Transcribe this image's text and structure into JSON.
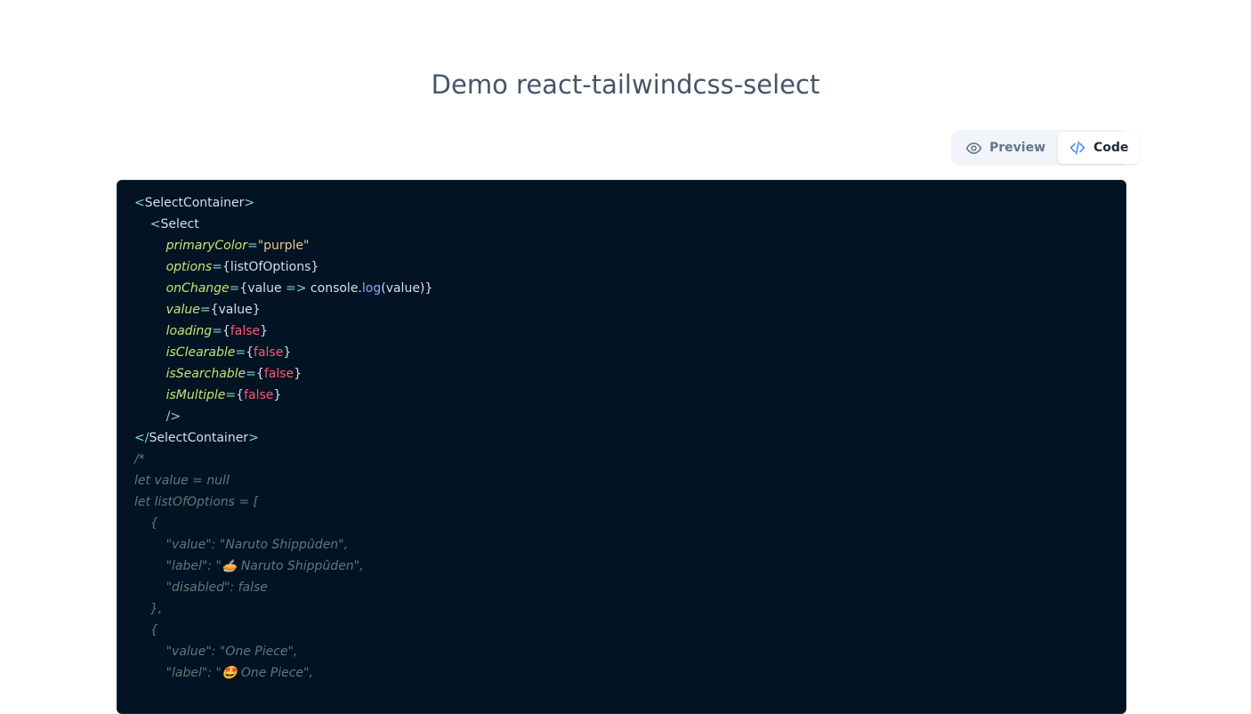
{
  "page": {
    "title": "Demo react-tailwindcss-select"
  },
  "tabs": [
    {
      "label": "Preview",
      "icon": "eye-icon",
      "active": false
    },
    {
      "label": "Code",
      "icon": "code-icon",
      "active": true
    }
  ],
  "code": {
    "lines": [
      [
        {
          "t": "<",
          "c": "punc"
        },
        {
          "t": "SelectContainer",
          "c": "tag"
        },
        {
          "t": ">",
          "c": "punc"
        }
      ],
      [
        {
          "t": "    <",
          "c": "punc"
        },
        {
          "t": "Select",
          "c": "tag"
        }
      ],
      [
        {
          "t": "        ",
          "c": "ident"
        },
        {
          "t": "primaryColor",
          "c": "attr"
        },
        {
          "t": "=",
          "c": "punc"
        },
        {
          "t": "\"purple\"",
          "c": "str"
        }
      ],
      [
        {
          "t": "        ",
          "c": "ident"
        },
        {
          "t": "options",
          "c": "attr"
        },
        {
          "t": "=",
          "c": "punc"
        },
        {
          "t": "{",
          "c": "brace"
        },
        {
          "t": "listOfOptions",
          "c": "ident"
        },
        {
          "t": "}",
          "c": "brace"
        }
      ],
      [
        {
          "t": "        ",
          "c": "ident"
        },
        {
          "t": "onChange",
          "c": "attr"
        },
        {
          "t": "=",
          "c": "punc"
        },
        {
          "t": "{",
          "c": "brace"
        },
        {
          "t": "value ",
          "c": "ident"
        },
        {
          "t": "=>",
          "c": "punc"
        },
        {
          "t": " console.",
          "c": "ident"
        },
        {
          "t": "log",
          "c": "call"
        },
        {
          "t": "(value)}",
          "c": "ident"
        }
      ],
      [
        {
          "t": "        ",
          "c": "ident"
        },
        {
          "t": "value",
          "c": "attr"
        },
        {
          "t": "=",
          "c": "punc"
        },
        {
          "t": "{",
          "c": "brace"
        },
        {
          "t": "value",
          "c": "ident"
        },
        {
          "t": "}",
          "c": "brace"
        }
      ],
      [
        {
          "t": "        ",
          "c": "ident"
        },
        {
          "t": "loading",
          "c": "attr"
        },
        {
          "t": "=",
          "c": "punc"
        },
        {
          "t": "{",
          "c": "brace"
        },
        {
          "t": "false",
          "c": "false"
        },
        {
          "t": "}",
          "c": "brace"
        }
      ],
      [
        {
          "t": "        ",
          "c": "ident"
        },
        {
          "t": "isClearable",
          "c": "attr"
        },
        {
          "t": "=",
          "c": "punc"
        },
        {
          "t": "{",
          "c": "brace"
        },
        {
          "t": "false",
          "c": "false"
        },
        {
          "t": "}",
          "c": "brace"
        }
      ],
      [
        {
          "t": "        ",
          "c": "ident"
        },
        {
          "t": "isSearchable",
          "c": "attr"
        },
        {
          "t": "=",
          "c": "punc"
        },
        {
          "t": "{",
          "c": "brace"
        },
        {
          "t": "false",
          "c": "false"
        },
        {
          "t": "}",
          "c": "brace"
        }
      ],
      [
        {
          "t": "        ",
          "c": "ident"
        },
        {
          "t": "isMultiple",
          "c": "attr"
        },
        {
          "t": "=",
          "c": "punc"
        },
        {
          "t": "{",
          "c": "brace"
        },
        {
          "t": "false",
          "c": "false"
        },
        {
          "t": "}",
          "c": "brace"
        }
      ],
      [
        {
          "t": "        />",
          "c": "punc"
        }
      ],
      [
        {
          "t": "</",
          "c": "punc"
        },
        {
          "t": "SelectContainer",
          "c": "tag"
        },
        {
          "t": ">",
          "c": "punc"
        }
      ],
      [
        {
          "t": "/*",
          "c": "comment"
        }
      ],
      [
        {
          "t": "let value = null",
          "c": "comment"
        }
      ],
      [
        {
          "t": "let listOfOptions = [",
          "c": "comment"
        }
      ],
      [
        {
          "t": "    {",
          "c": "comment"
        }
      ],
      [
        {
          "t": "        \"value\": \"Naruto Shippûden\",",
          "c": "comment"
        }
      ],
      [
        {
          "t": "        \"label\": \"🥧 Naruto Shippûden\",",
          "c": "comment"
        }
      ],
      [
        {
          "t": "        \"disabled\": false",
          "c": "comment"
        }
      ],
      [
        {
          "t": "    },",
          "c": "comment"
        }
      ],
      [
        {
          "t": "    {",
          "c": "comment"
        }
      ],
      [
        {
          "t": "        \"value\": \"One Piece\",",
          "c": "comment"
        }
      ],
      [
        {
          "t": "        \"label\": \"🤩 One Piece\",",
          "c": "comment"
        }
      ]
    ]
  }
}
